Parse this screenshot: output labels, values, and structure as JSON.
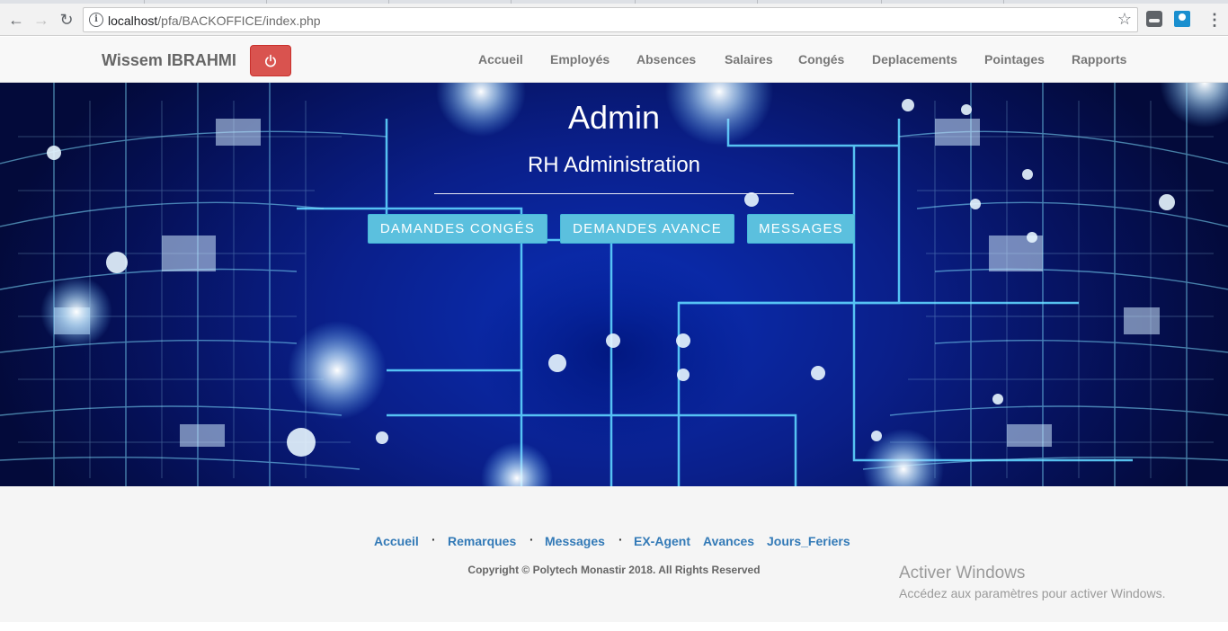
{
  "browser": {
    "url_host": "localhost",
    "url_path": "/pfa/BACKOFFICE/index.php"
  },
  "navbar": {
    "brand": "Wissem IBRAHMI",
    "links": [
      "Accueil",
      "Employés",
      "Absences",
      "Salaires",
      "Congés",
      "Deplacements",
      "Pointages",
      "Rapports"
    ]
  },
  "hero": {
    "title": "Admin",
    "subtitle": "RH Administration",
    "buttons": [
      "DAMANDES CONGÉS",
      "DEMANDES AVANCE",
      "MESSAGES"
    ]
  },
  "footer": {
    "links": [
      "Accueil",
      "Remarques",
      "Messages",
      "EX-Agent",
      "Avances",
      "Jours_Feriers"
    ],
    "separator": "·",
    "copyright": "Copyright © Polytech Monastir 2018. All Rights Reserved"
  },
  "watermark": {
    "title": "Activer Windows",
    "subtitle": "Accédez aux paramètres pour activer Windows."
  },
  "colors": {
    "danger": "#d9534f",
    "info": "#5bc0de",
    "link": "#337ab7"
  }
}
